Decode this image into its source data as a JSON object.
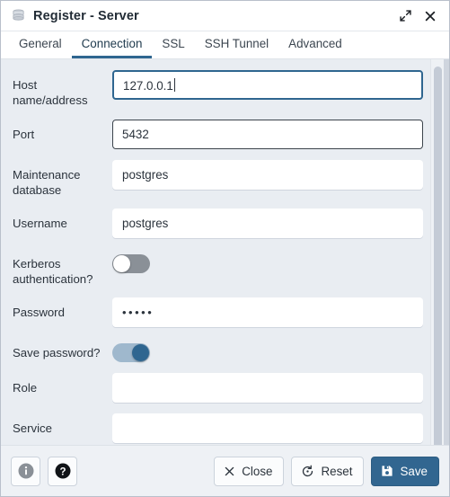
{
  "window": {
    "title": "Register - Server",
    "icon": "server-stack-icon",
    "maximize_label": "Maximize",
    "close_label": "Close"
  },
  "tabs": [
    {
      "label": "General",
      "active": false
    },
    {
      "label": "Connection",
      "active": true
    },
    {
      "label": "SSL",
      "active": false
    },
    {
      "label": "SSH Tunnel",
      "active": false
    },
    {
      "label": "Advanced",
      "active": false
    }
  ],
  "form": {
    "host": {
      "label": "Host name/address",
      "value": "127.0.0.1",
      "placeholder": ""
    },
    "port": {
      "label": "Port",
      "value": "5432",
      "placeholder": ""
    },
    "maintenance_db": {
      "label": "Maintenance database",
      "value": "postgres",
      "placeholder": ""
    },
    "username": {
      "label": "Username",
      "value": "postgres",
      "placeholder": ""
    },
    "kerberos": {
      "label": "Kerberos authentication?",
      "state": "off"
    },
    "password": {
      "label": "Password",
      "value": "•••••",
      "placeholder": ""
    },
    "save_password": {
      "label": "Save password?",
      "state": "on"
    },
    "role": {
      "label": "Role",
      "value": "",
      "placeholder": ""
    },
    "service": {
      "label": "Service",
      "value": "",
      "placeholder": ""
    }
  },
  "footer": {
    "info_label": "i",
    "help_label": "?",
    "close_label": "Close",
    "reset_label": "Reset",
    "save_label": "Save"
  },
  "colors": {
    "accent": "#326690",
    "tab_underline": "#2f6690",
    "focus_border": "#2f6690",
    "toggle_on": "#2f6690",
    "toggle_off": "#8a9097",
    "dialog_bg": "#e9edf2",
    "field_bg": "#ffffff"
  }
}
